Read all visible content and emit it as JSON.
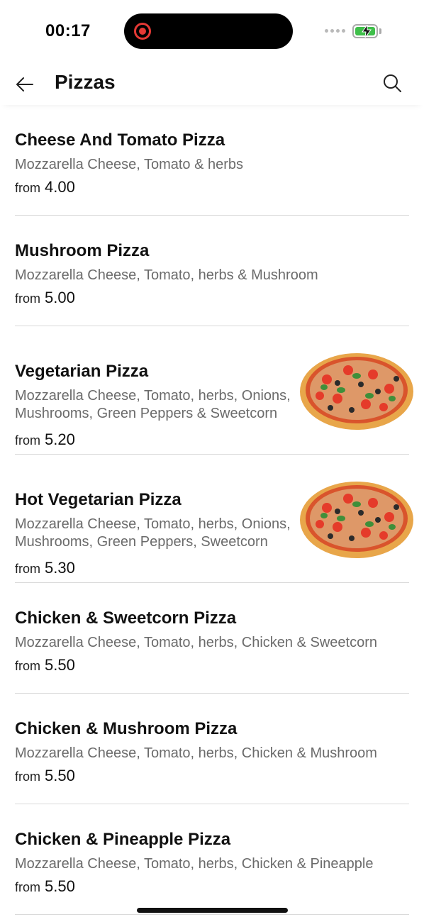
{
  "status_bar": {
    "time": "00:17"
  },
  "header": {
    "title": "Pizzas",
    "back_icon": "arrow-left-icon",
    "search_icon": "search-icon"
  },
  "items": [
    {
      "name": "Cheese And Tomato Pizza",
      "description": "Mozzarella Cheese, Tomato & herbs",
      "from_label": "from",
      "price": "4.00"
    },
    {
      "name": "Mushroom Pizza",
      "description": "Mozzarella Cheese, Tomato, herbs & Mushroom",
      "from_label": "from",
      "price": "5.00"
    },
    {
      "name": "Vegetarian Pizza",
      "description": "Mozzarella Cheese, Tomato, herbs, Onions, Mushrooms, Green Peppers & Sweetcorn",
      "from_label": "from",
      "price": "5.20"
    },
    {
      "name": "Hot Vegetarian Pizza",
      "description": "Mozzarella Cheese, Tomato, herbs, Onions, Mushrooms, Green Peppers, Sweetcorn &…",
      "from_label": "from",
      "price": "5.30"
    },
    {
      "name": "Chicken & Sweetcorn Pizza",
      "description": "Mozzarella Cheese, Tomato, herbs, Chicken & Sweetcorn",
      "from_label": "from",
      "price": "5.50"
    },
    {
      "name": "Chicken & Mushroom Pizza",
      "description": "Mozzarella Cheese, Tomato, herbs, Chicken & Mushroom",
      "from_label": "from",
      "price": "5.50"
    },
    {
      "name": "Chicken & Pineapple Pizza",
      "description": "Mozzarella Cheese, Tomato, herbs, Chicken & Pineapple",
      "from_label": "from",
      "price": "5.50"
    }
  ]
}
